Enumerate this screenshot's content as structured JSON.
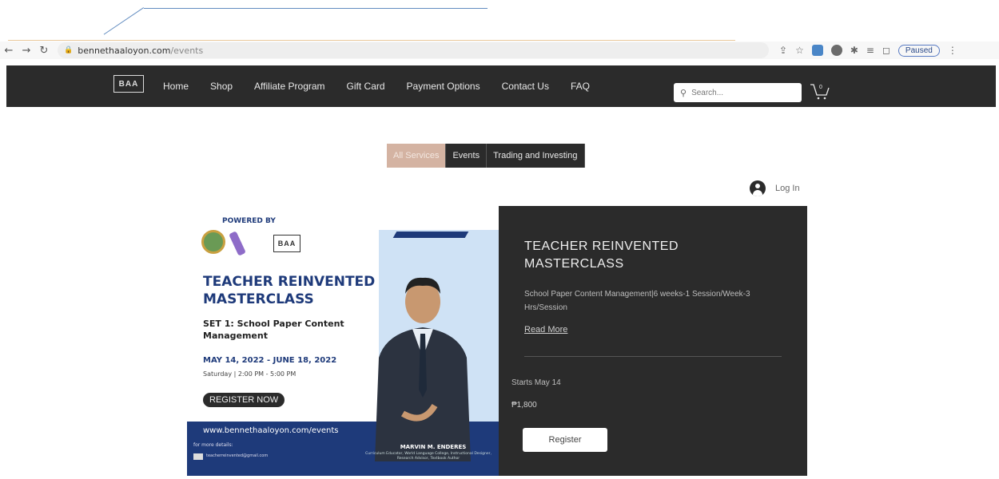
{
  "browser": {
    "url_host": "bennethaaloyon.com",
    "url_path": "/events",
    "paused_label": "Paused"
  },
  "site": {
    "logo_text": "BAA",
    "menu": [
      "Home",
      "Shop",
      "Affiliate Program",
      "Gift Card",
      "Payment Options",
      "Contact Us",
      "FAQ"
    ],
    "search_placeholder": "Search...",
    "cart_count": "0"
  },
  "filters": {
    "tabs": [
      "All Services",
      "Events",
      "Trading and Investing"
    ]
  },
  "account": {
    "login_label": "Log In"
  },
  "event": {
    "poster": {
      "powered_by": "POWERED BY",
      "logo_text": "BAA",
      "title": "TEACHER REINVENTED MASTERCLASS",
      "set": "SET 1: School Paper Content Management",
      "dates": "MAY 14, 2022 - JUNE 18, 2022",
      "time": "Saturday | 2:00 PM - 5:00 PM",
      "register": "REGISTER NOW",
      "url": "www.bennethaaloyon.com/events",
      "more_details": "for more details:",
      "email": "teacherreinvented@gmail.com",
      "speaker_name": "MARVIN M. ENDERES",
      "speaker_role": "Curriculum Educator, World Language College, Instructional Designer, Research Advisor, Textbook Author"
    },
    "title": "TEACHER REINVENTED MASTERCLASS",
    "description": "School Paper Content Management|6 weeks-1 Session/Week-3 Hrs/Session",
    "read_more": "Read More",
    "starts": "Starts May 14",
    "price": "₱1,800",
    "register_label": "Register"
  },
  "colors": {
    "nav_bg": "#2b2b2b",
    "active_tab": "#d4b3a2",
    "poster_blue": "#1e3a7a"
  }
}
